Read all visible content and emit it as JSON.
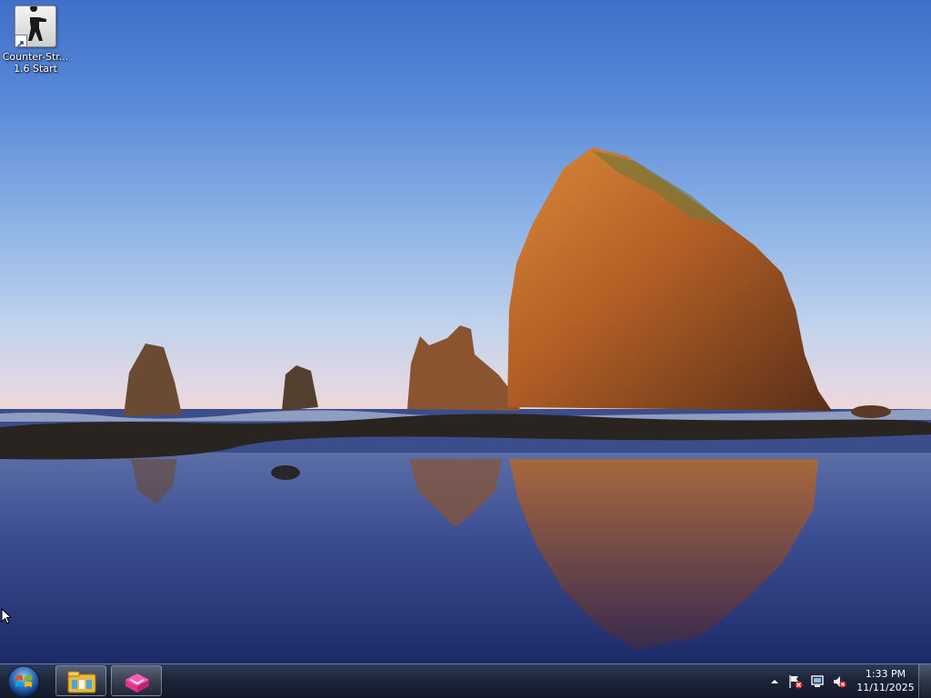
{
  "desktop": {
    "icons": [
      {
        "label_line1": "Counter-Str...",
        "label_line2": "1.6 Start",
        "icon": "counter-strike-soldier-icon"
      }
    ]
  },
  "taskbar": {
    "start_button": "windows-orb-icon",
    "pinned": [
      {
        "name": "file-explorer",
        "icon": "folder-library-icon"
      },
      {
        "name": "pink-app",
        "icon": "pink-box-app-icon"
      }
    ],
    "tray": {
      "icons": [
        "show-hidden-icons-arrow",
        "action-center-flag-icon",
        "network-icon",
        "volume-muted-icon"
      ],
      "time": "1:33 PM",
      "date": "11/11/2025"
    }
  },
  "colors": {
    "taskbar": "#1b2538",
    "sky_top": "#3f6fc8",
    "rock": "#b8662a",
    "water": "#2a3a7a"
  }
}
